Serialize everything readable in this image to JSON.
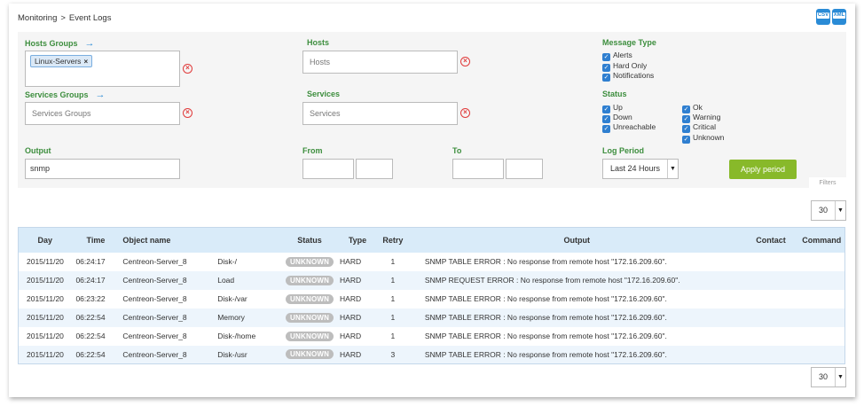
{
  "breadcrumb": {
    "section": "Monitoring",
    "separator": ">",
    "page": "Event Logs"
  },
  "export": {
    "csv": "CSV",
    "xml": "XML"
  },
  "filters": {
    "hosts_groups": {
      "label": "Hosts Groups",
      "chip": "Linux-Servers"
    },
    "hosts": {
      "label": "Hosts",
      "placeholder": "Hosts"
    },
    "services_groups": {
      "label": "Services Groups",
      "placeholder": "Services Groups"
    },
    "services": {
      "label": "Services",
      "placeholder": "Services"
    },
    "output": {
      "label": "Output",
      "value": "snmp"
    },
    "from": {
      "label": "From"
    },
    "to": {
      "label": "To"
    },
    "message_type": {
      "label": "Message Type",
      "options": [
        "Alerts",
        "Hard Only",
        "Notifications"
      ]
    },
    "status": {
      "label": "Status",
      "host_options": [
        "Up",
        "Down",
        "Unreachable"
      ],
      "service_options": [
        "Ok",
        "Warning",
        "Critical",
        "Unknown"
      ]
    },
    "log_period": {
      "label": "Log Period",
      "value": "Last 24 Hours"
    },
    "apply_label": "Apply period",
    "tab_label": "Filters"
  },
  "pagination": {
    "top_value": "30",
    "bottom_value": "30"
  },
  "table": {
    "headers": [
      "Day",
      "Time",
      "Object name",
      "",
      "Status",
      "Type",
      "Retry",
      "Output",
      "Contact",
      "Command"
    ],
    "rows": [
      {
        "day": "2015/11/20",
        "time": "06:24:17",
        "host": "Centreon-Server_8",
        "service": "Disk-/",
        "status": "UNKNOWN",
        "type": "HARD",
        "retry": "1",
        "output": "SNMP TABLE ERROR : No response from remote host \"172.16.209.60\"."
      },
      {
        "day": "2015/11/20",
        "time": "06:24:17",
        "host": "Centreon-Server_8",
        "service": "Load",
        "status": "UNKNOWN",
        "type": "HARD",
        "retry": "1",
        "output": "SNMP REQUEST ERROR : No response from remote host \"172.16.209.60\"."
      },
      {
        "day": "2015/11/20",
        "time": "06:23:22",
        "host": "Centreon-Server_8",
        "service": "Disk-/var",
        "status": "UNKNOWN",
        "type": "HARD",
        "retry": "1",
        "output": "SNMP TABLE ERROR : No response from remote host \"172.16.209.60\"."
      },
      {
        "day": "2015/11/20",
        "time": "06:22:54",
        "host": "Centreon-Server_8",
        "service": "Memory",
        "status": "UNKNOWN",
        "type": "HARD",
        "retry": "1",
        "output": "SNMP TABLE ERROR : No response from remote host \"172.16.209.60\"."
      },
      {
        "day": "2015/11/20",
        "time": "06:22:54",
        "host": "Centreon-Server_8",
        "service": "Disk-/home",
        "status": "UNKNOWN",
        "type": "HARD",
        "retry": "1",
        "output": "SNMP TABLE ERROR : No response from remote host \"172.16.209.60\"."
      },
      {
        "day": "2015/11/20",
        "time": "06:22:54",
        "host": "Centreon-Server_8",
        "service": "Disk-/usr",
        "status": "UNKNOWN",
        "type": "HARD",
        "retry": "3",
        "output": "SNMP TABLE ERROR : No response from remote host \"172.16.209.60\"."
      }
    ]
  },
  "colors": {
    "label_green": "#3d8e3e",
    "accent_blue": "#2a8bd6",
    "apply_green": "#88b92a",
    "table_header": "#d9ebf9",
    "status_unknown": "#bdbdbd"
  }
}
